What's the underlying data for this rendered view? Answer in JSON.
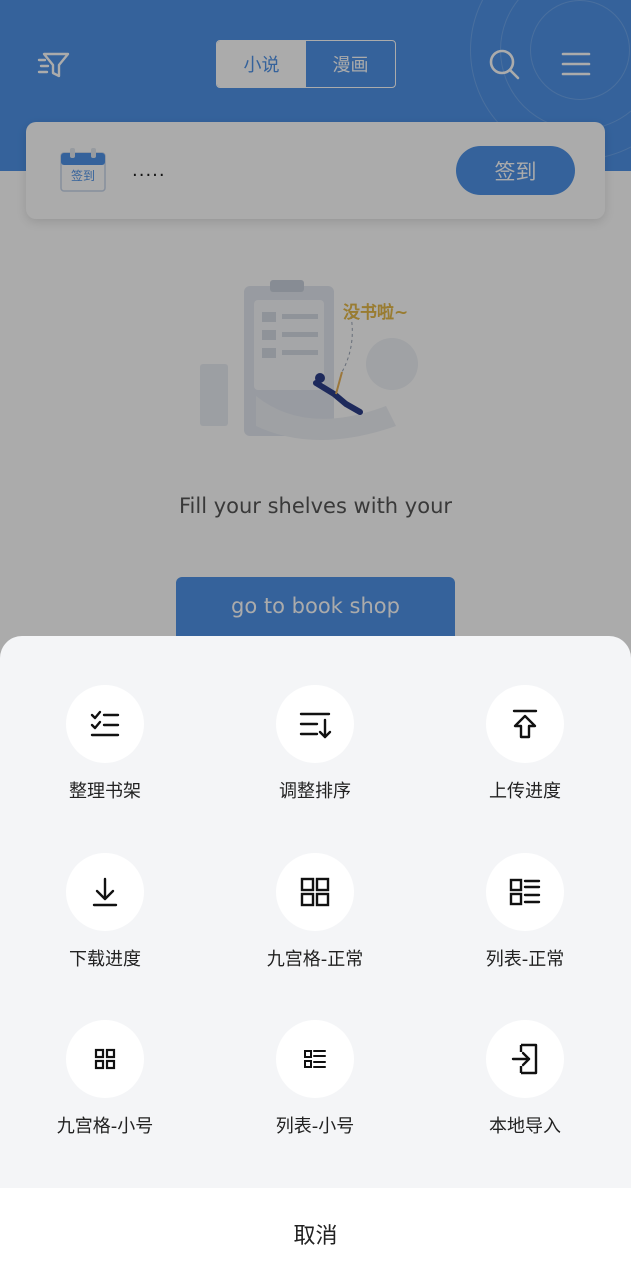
{
  "header": {
    "tabs": [
      {
        "label": "小说",
        "active": true
      },
      {
        "label": "漫画",
        "active": false
      }
    ],
    "icons": [
      "filter-icon",
      "search-icon",
      "menu-icon"
    ],
    "accent_color": "#4f93e8"
  },
  "signin": {
    "calendar_label": "签到",
    "status": ".....",
    "button_label": "签到"
  },
  "empty_state": {
    "illustration_caption": "没书啦~",
    "message": "Fill your shelves with your",
    "shop_button": "go to book shop"
  },
  "sheet": {
    "items": [
      {
        "label": "整理书架",
        "icon": "checklist-icon"
      },
      {
        "label": "调整排序",
        "icon": "sort-icon"
      },
      {
        "label": "上传进度",
        "icon": "upload-icon"
      },
      {
        "label": "下载进度",
        "icon": "download-icon"
      },
      {
        "label": "九宫格-正常",
        "icon": "grid-normal-icon"
      },
      {
        "label": "列表-正常",
        "icon": "list-normal-icon"
      },
      {
        "label": "九宫格-小号",
        "icon": "grid-small-icon"
      },
      {
        "label": "列表-小号",
        "icon": "list-small-icon"
      },
      {
        "label": "本地导入",
        "icon": "import-icon"
      }
    ],
    "cancel_label": "取消"
  }
}
